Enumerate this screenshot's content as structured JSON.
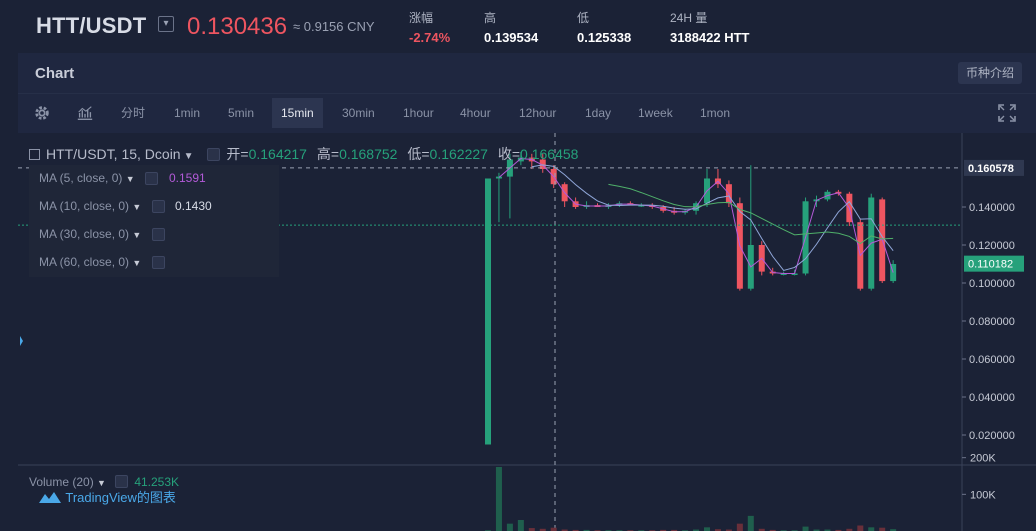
{
  "header": {
    "pair": "HTT/USDT",
    "last_price": "0.130436",
    "cny": "≈ 0.9156 CNY",
    "stats": [
      {
        "label": "涨幅",
        "value": "-2.74%"
      },
      {
        "label": "高",
        "value": "0.139534"
      },
      {
        "label": "低",
        "value": "0.125338"
      },
      {
        "label": "24H 量",
        "value": "3188422 HTT"
      }
    ]
  },
  "panel": {
    "title": "Chart",
    "intro_button": "币种介绍"
  },
  "toolbar": {
    "intervals": [
      "分时",
      "1min",
      "5min",
      "15min",
      "30min",
      "1hour",
      "4hour",
      "12hour",
      "1day",
      "1week",
      "1mon"
    ],
    "active": "15min"
  },
  "legend": {
    "symbol": "HTT/USDT, 15, Dcoin",
    "open_label": "开=",
    "open": "0.164217",
    "high_label": "高=",
    "high": "0.168752",
    "low_label": "低=",
    "low": "0.162227",
    "close_label": "收=",
    "close": "0.166458"
  },
  "ma": [
    {
      "label": "MA (5, close, 0)",
      "value": "0.1591",
      "color": "#b35ad8"
    },
    {
      "label": "MA (10, close, 0)",
      "value": "0.1430",
      "color": "#d8dce6"
    },
    {
      "label": "MA (30, close, 0)",
      "value": "",
      "color": ""
    },
    {
      "label": "MA (60, close, 0)",
      "value": "",
      "color": ""
    }
  ],
  "price_axis": {
    "ticks": [
      "0.140000",
      "0.120000",
      "0.100000",
      "0.080000",
      "0.060000",
      "0.040000",
      "0.020000"
    ],
    "crosshair_price": "0.160578",
    "last_price_label": "0.110182"
  },
  "volume": {
    "label": "Volume (20)",
    "value": "41.253K",
    "ticks": [
      "200K",
      "100K"
    ]
  },
  "branding": "TradingView的图表",
  "colors": {
    "up": "#26a17b",
    "down": "#ee5560",
    "accent": "#4aa8e8"
  },
  "chart_data": {
    "type": "candlestick",
    "y_range": [
      0.0,
      0.17
    ],
    "candles": [
      {
        "o": 0.015,
        "h": 0.155,
        "l": 0.015,
        "c": 0.155
      },
      {
        "o": 0.155,
        "h": 0.158,
        "l": 0.132,
        "c": 0.156
      },
      {
        "o": 0.156,
        "h": 0.168,
        "l": 0.134,
        "c": 0.165
      },
      {
        "o": 0.164,
        "h": 0.169,
        "l": 0.162,
        "c": 0.166
      },
      {
        "o": 0.166,
        "h": 0.168,
        "l": 0.16,
        "c": 0.164
      },
      {
        "o": 0.165,
        "h": 0.168,
        "l": 0.158,
        "c": 0.16
      },
      {
        "o": 0.16,
        "h": 0.162,
        "l": 0.15,
        "c": 0.152
      },
      {
        "o": 0.152,
        "h": 0.153,
        "l": 0.14,
        "c": 0.143
      },
      {
        "o": 0.143,
        "h": 0.145,
        "l": 0.139,
        "c": 0.14
      },
      {
        "o": 0.14,
        "h": 0.143,
        "l": 0.139,
        "c": 0.141
      },
      {
        "o": 0.141,
        "h": 0.142,
        "l": 0.14,
        "c": 0.14
      },
      {
        "o": 0.14,
        "h": 0.142,
        "l": 0.139,
        "c": 0.141
      },
      {
        "o": 0.141,
        "h": 0.143,
        "l": 0.14,
        "c": 0.142
      },
      {
        "o": 0.142,
        "h": 0.143,
        "l": 0.141,
        "c": 0.141
      },
      {
        "o": 0.141,
        "h": 0.142,
        "l": 0.14,
        "c": 0.141
      },
      {
        "o": 0.141,
        "h": 0.142,
        "l": 0.139,
        "c": 0.14
      },
      {
        "o": 0.14,
        "h": 0.141,
        "l": 0.137,
        "c": 0.138
      },
      {
        "o": 0.138,
        "h": 0.14,
        "l": 0.136,
        "c": 0.137
      },
      {
        "o": 0.137,
        "h": 0.139,
        "l": 0.136,
        "c": 0.138
      },
      {
        "o": 0.138,
        "h": 0.143,
        "l": 0.136,
        "c": 0.142
      },
      {
        "o": 0.142,
        "h": 0.16,
        "l": 0.14,
        "c": 0.155
      },
      {
        "o": 0.155,
        "h": 0.16,
        "l": 0.15,
        "c": 0.152
      },
      {
        "o": 0.152,
        "h": 0.154,
        "l": 0.14,
        "c": 0.142
      },
      {
        "o": 0.142,
        "h": 0.145,
        "l": 0.096,
        "c": 0.097
      },
      {
        "o": 0.097,
        "h": 0.162,
        "l": 0.096,
        "c": 0.12
      },
      {
        "o": 0.12,
        "h": 0.122,
        "l": 0.104,
        "c": 0.106
      },
      {
        "o": 0.106,
        "h": 0.108,
        "l": 0.104,
        "c": 0.105
      },
      {
        "o": 0.105,
        "h": 0.106,
        "l": 0.104,
        "c": 0.105
      },
      {
        "o": 0.105,
        "h": 0.107,
        "l": 0.104,
        "c": 0.105
      },
      {
        "o": 0.105,
        "h": 0.145,
        "l": 0.104,
        "c": 0.143
      },
      {
        "o": 0.143,
        "h": 0.146,
        "l": 0.14,
        "c": 0.144
      },
      {
        "o": 0.144,
        "h": 0.149,
        "l": 0.143,
        "c": 0.148
      },
      {
        "o": 0.148,
        "h": 0.149,
        "l": 0.146,
        "c": 0.147
      },
      {
        "o": 0.147,
        "h": 0.148,
        "l": 0.13,
        "c": 0.132
      },
      {
        "o": 0.132,
        "h": 0.134,
        "l": 0.096,
        "c": 0.097
      },
      {
        "o": 0.097,
        "h": 0.147,
        "l": 0.096,
        "c": 0.145
      },
      {
        "o": 0.144,
        "h": 0.145,
        "l": 0.1,
        "c": 0.101
      },
      {
        "o": 0.101,
        "h": 0.112,
        "l": 0.1,
        "c": 0.11
      }
    ],
    "volumes": [
      2000,
      290000,
      20000,
      30000,
      8000,
      6000,
      9000,
      4000,
      3000,
      3000,
      2000,
      2000,
      2000,
      2000,
      2000,
      2000,
      3000,
      3000,
      2000,
      4000,
      10000,
      5000,
      4000,
      20000,
      41253,
      6000,
      3000,
      2000,
      2000,
      12000,
      4000,
      4000,
      3000,
      6000,
      15000,
      10000,
      9000,
      5000
    ]
  }
}
